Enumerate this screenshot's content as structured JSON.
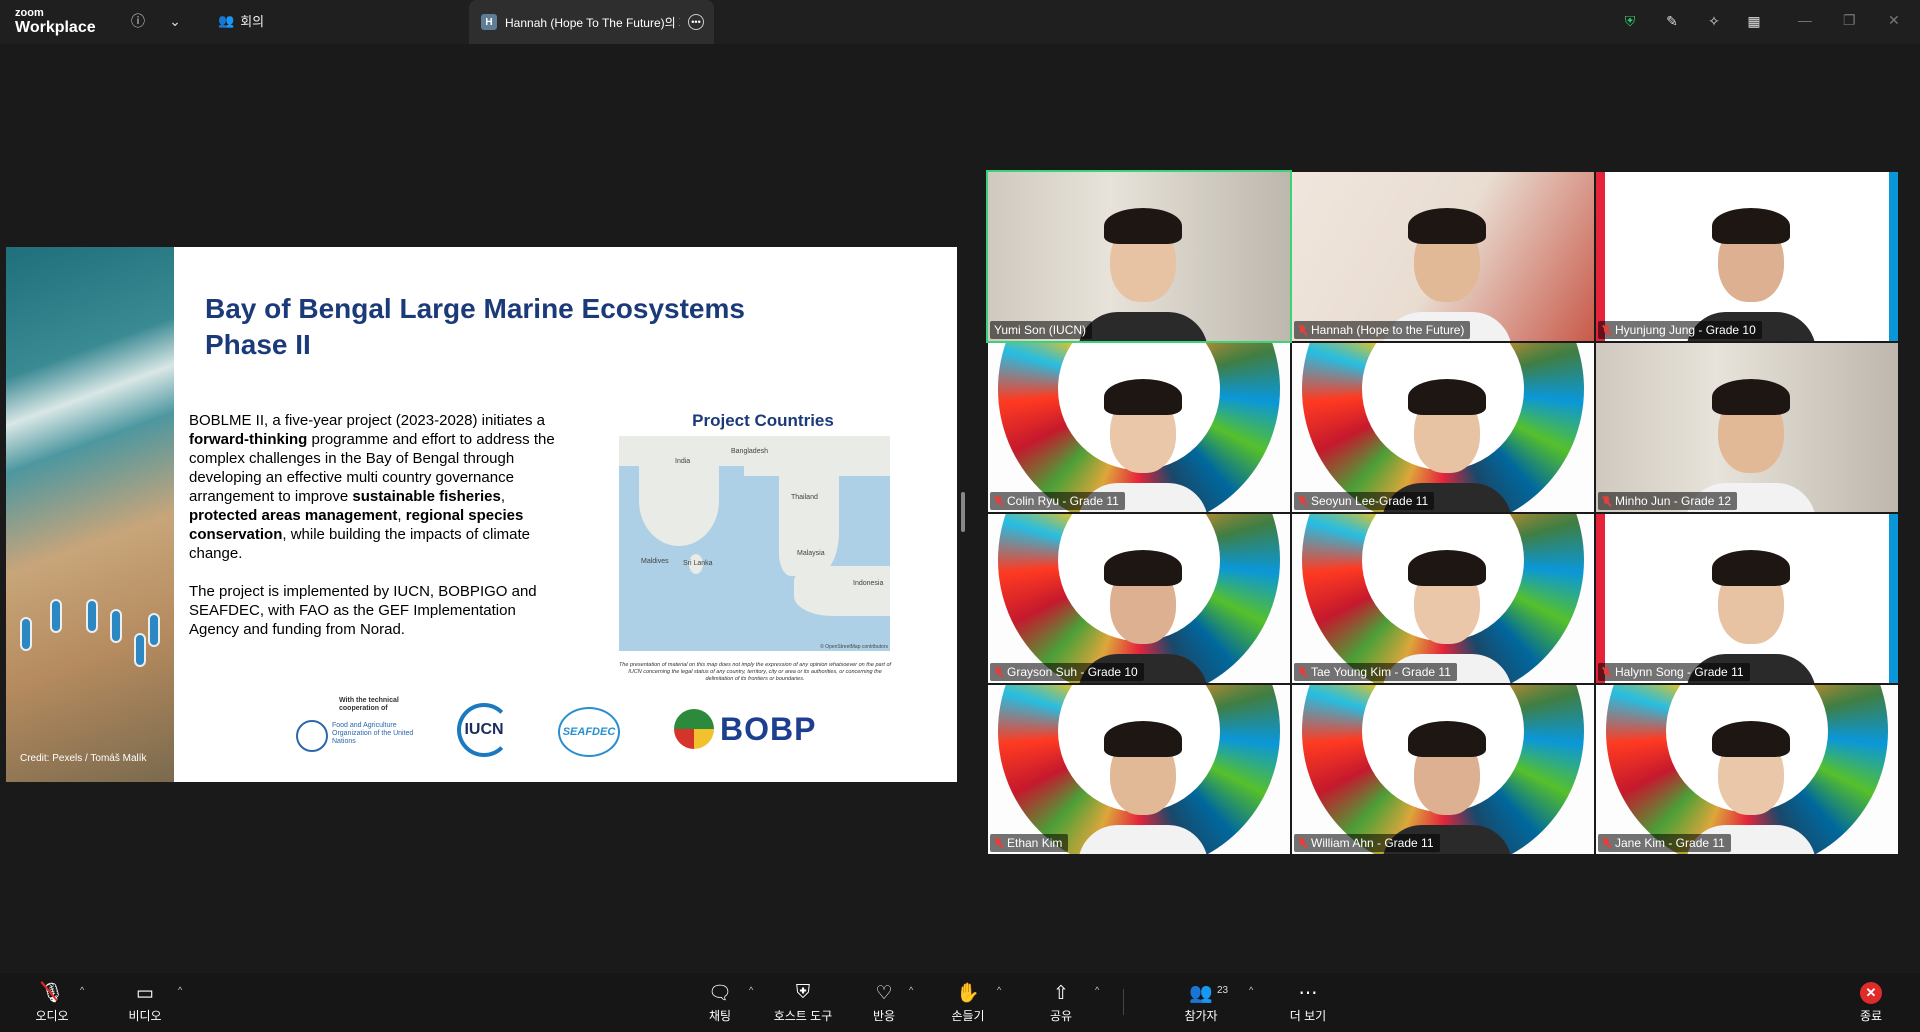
{
  "app": {
    "brand_small": "zoom",
    "brand_big": "Workplace"
  },
  "titlebar": {
    "meeting_label": "회의",
    "tab_initial": "H",
    "tab_title": "Hannah (Hope To The Future)의 화면"
  },
  "slide": {
    "title": "Bay of Bengal Large Marine Ecosystems Phase II",
    "credit": "Credit: Pexels / Tomáš Malík",
    "para1_a": "BOBLME II, a five-year project (2023-2028) initiates a ",
    "para1_b": "forward-thinking",
    "para1_c": " programme and effort to address the complex challenges in the Bay of Bengal through developing an effective multi country governance arrangement to improve ",
    "para1_d": "sustainable fisheries",
    "para1_e": ", ",
    "para1_f": "protected areas management",
    "para1_g": ", ",
    "para1_h": "regional species conservation",
    "para1_i": ", while building the impacts of climate change.",
    "para2": "The project is implemented by IUCN, BOBPIGO and SEAFDEC, with FAO as the GEF Implementation Agency and funding from Norad.",
    "project_countries": "Project Countries",
    "map_labels": {
      "india": "India",
      "bangladesh": "Bangladesh",
      "thailand": "Thailand",
      "maldives": "Maldives",
      "srilanka": "Sri Lanka",
      "malaysia": "Malaysia",
      "indonesia": "Indonesia",
      "osm": "© OpenStreetMap contributors"
    },
    "disclaimer": "The presentation of material on this map does not imply the expression of any opinion whatsoever on the part of IUCN concerning the legal status of any country, territory, city or area or its authorities, or concerning the delimitation of its frontiers or boundaries.",
    "fao_tech": "With the technical cooperation of",
    "fao_name": "Food and Agriculture Organization of the United Nations",
    "iucn": "IUCN",
    "seafdec": "SEAFDEC",
    "bobp": "BOBP"
  },
  "participants": [
    {
      "name": "Yumi Son (IUCN)",
      "muted": false,
      "active": true,
      "bg": "room"
    },
    {
      "name": "Hannah (Hope to the Future)",
      "muted": true,
      "active": false,
      "bg": "poster"
    },
    {
      "name": "Hyunjung Jung - Grade 10",
      "muted": true,
      "active": false,
      "bg": "white"
    },
    {
      "name": "Colin Ryu - Grade 11",
      "muted": true,
      "active": false,
      "bg": "sdg"
    },
    {
      "name": "Seoyun Lee-Grade 11",
      "muted": true,
      "active": false,
      "bg": "sdg"
    },
    {
      "name": "Minho Jun - Grade 12",
      "muted": true,
      "active": false,
      "bg": "room"
    },
    {
      "name": "Grayson Suh - Grade 10",
      "muted": true,
      "active": false,
      "bg": "sdg"
    },
    {
      "name": "Tae Young Kim - Grade 11",
      "muted": true,
      "active": false,
      "bg": "sdg"
    },
    {
      "name": "Halynn Song - Grade 11",
      "muted": true,
      "active": false,
      "bg": "white"
    },
    {
      "name": "Ethan Kim",
      "muted": true,
      "active": false,
      "bg": "sdg"
    },
    {
      "name": "William Ahn - Grade 11",
      "muted": true,
      "active": false,
      "bg": "sdg"
    },
    {
      "name": "Jane Kim - Grade 11",
      "muted": true,
      "active": false,
      "bg": "sdg"
    }
  ],
  "toolbar": {
    "audio": "오디오",
    "video": "비디오",
    "chat": "채팅",
    "host_tools": "호스트 도구",
    "reactions": "반응",
    "raise_hand": "손들기",
    "share": "공유",
    "participants": "참가자",
    "participants_count": "23",
    "more": "더 보기",
    "end": "종료"
  },
  "colors": {
    "active_border": "#3cd27a",
    "end_red": "#e02b2b",
    "slide_title": "#1b3a7a"
  }
}
